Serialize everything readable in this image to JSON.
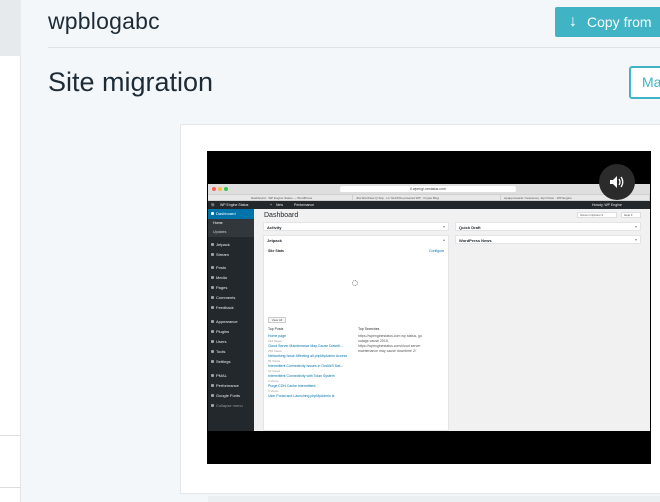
{
  "header": {
    "site_name": "wpblogabc",
    "copy_button_label": "Copy from"
  },
  "page": {
    "title": "Site migration",
    "action_button_label": "Ma"
  },
  "video": {
    "browser": {
      "url": "tl.wpengi-nestatus.com",
      "tabs": [
        "Dashboard · WP Engine Status — WordPress",
        "Jira WorrFlow Q Sop · H / GLFFOs powered WP · Crypto Blog",
        "wpapprovetral / Grassroa | Jopi Posto · WP Engine"
      ]
    },
    "admin_bar": {
      "site": "WP Engine Status",
      "new": "New",
      "performance": "Performance",
      "howdy": "Howdy, WP Engine"
    },
    "menu": {
      "dashboard": "Dashboard",
      "home": "Home",
      "updates": "Updates",
      "items": [
        "Jetpack",
        "Stream",
        "Posts",
        "Media",
        "Pages",
        "Comments",
        "Feedback",
        "Appearance",
        "Plugins",
        "Users",
        "Tools",
        "Settings",
        "PMAL",
        "Performance",
        "Google Fonts",
        "Collapse menu"
      ]
    },
    "dashboard": {
      "title": "Dashboard",
      "screen_options": "Screen Options ▾",
      "help": "Help ▾",
      "activity": "Activity",
      "quick_draft": "Quick Draft",
      "jetpack": "Jetpack",
      "wordpress_news": "WordPress News",
      "site_stats": "Site Stats",
      "configure": "Configure",
      "view_all": "View All",
      "top_posts_heading": "Top Posts",
      "top_searches_heading": "Top Searches",
      "top_posts": [
        {
          "title": "Home page",
          "views": "244 Views"
        },
        {
          "title": "Cloud Server Maintenance May Cause Downti...",
          "views": "255 Views"
        },
        {
          "title": "Networking Issue Affecting all phpMyAdmin Access",
          "views": "55 Views"
        },
        {
          "title": "Intermittent Connectivity Issues in OnAWS Dat...",
          "views": "10 Views"
        },
        {
          "title": "Intermittent Connectivity with Tolan System",
          "views": "3 Views"
        },
        {
          "title": "Purge CDN Cache Intermittent",
          "views": "3 Views"
        },
        {
          "title": "User Portal and Launching phpMyAdmin is",
          "views": ""
        }
      ],
      "top_searches": [
        "https://wpenginestatus.com wp status, go",
        "outage cause 2015,",
        "https://wpenginestatus.com/cloud server",
        "maintenance may cause downtime 2/"
      ]
    }
  }
}
